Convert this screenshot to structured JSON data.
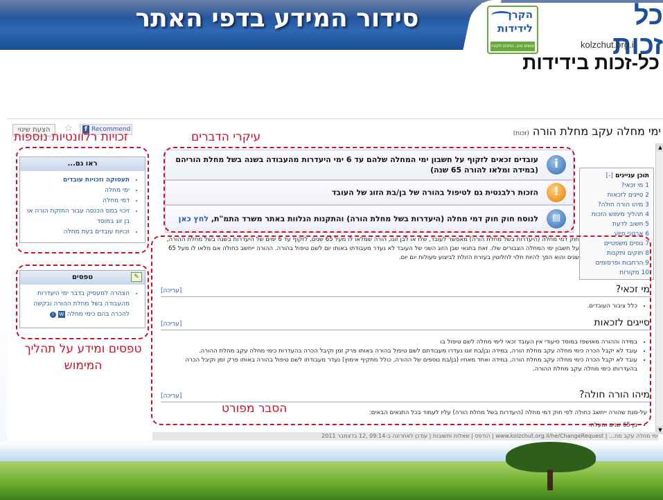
{
  "slide": {
    "title": "סידור המידע בדפי האתר",
    "logo_title": "כל זכות",
    "logo_url": "kolzchut.org.il",
    "fund_logo_line1": "הקרן",
    "fund_logo_line2": "לידידות",
    "fund_logo_tagline": "עושים טוב, נותנים תקווה",
    "subtitle": "כל-זכות בידידות"
  },
  "page": {
    "title": "ימי מחלה עקב מחלת הורה",
    "title_tag": "(זכות)",
    "suggest_button": "הצעת שינוי",
    "recommend_button": "Recommend"
  },
  "toc": {
    "heading": "תוכן עניינים",
    "toggle": "[-]",
    "items": [
      "1 מי זכאי?",
      "2 סייגים לזכאות",
      "3 מיהו הורה חולה?",
      "4 תהליך מימוש הזכות",
      "5 חשוב לדעת",
      "6 ארגוני סיוע",
      "7 גופים משפטיים",
      "8 חוקים ותקנות",
      "9 הרחבות ופרסומים",
      "10 מקורות"
    ]
  },
  "highlights": [
    {
      "text": "עובדים זכאים לזקוף על חשבון ימי המחלה שלהם עד 6 ימי היעדרות מהעבודה בשנה בשל מחלת הוריהם (במידה ומלאו להורה 65 שנה)",
      "icon": "i"
    },
    {
      "text": "הזכות רלבנטית גם לטיפול בהורה של בן/בת הזוג של העובד",
      "icon": "!"
    },
    {
      "text": "לנוסח חוק חוק דמי מחלה (היעדרות בשל מחלת הורה) והתקנות הנלוות באתר משרד התמ\"ת,",
      "link": "לחץ כאן",
      "icon": "book"
    }
  ],
  "intro": {
    "text": "חוק דמי מחלה (היעדרות בשל מחלת הורה) מאפשר לעובד, שלו או לבן זוגו, הורה שמלאו לו מעל 65 שנים, לזקוף עד 6 ימים של היעדרות בשנה בשל מחלת ההורה, על חשבון ימי המחלה הצבורים שלו. זאת בתנאי שבן הזוג השני של העובד לא נעדר מעבודתו באותו יום לשם טיפול בהורה. ההורה ייחשב כחולה אם מלאו לו מעל 65 שנים והוא הפך להיות תלוי לחלוטין בעזרת הזולת לביצוע פעולות יום יום."
  },
  "sections": [
    {
      "heading": "מי זכאי?",
      "edit": "[עריכה]",
      "bullets": [
        "כלל ציבור העובדים."
      ]
    },
    {
      "heading": "סייגים לזכאות",
      "edit": "[עריכה]",
      "bullets": [
        "במידה וההורה מאושפז במוסד סיעודי אין העובד זכאי לימי מחלה לשם טיפול בו",
        "עובד לא יקבל הכרה כימי מחלה עקב מחלת הורה, במידה ובן/בת זוגו נעדרו מעבודתם לשם טיפול בהורה באותו פרק זמן וקיבל הכרה בהעדרות כימי מחלה עקב מחלת ההורה.",
        "עובד לא יקבל הכרה כימי מחלה עקב מחלת הורה, במידה ואחד מאחיו (בן/בת נוספים של ההורה, כולל מתקיף אימוץ) נעדר מעבודתו לשם טיפול בהורה באותו פרק זמן וקיבל הכרה בהעדרותו כימי מחלה עקב מחלת ההורה."
      ]
    },
    {
      "heading": "מיהו הורה חולה?",
      "edit": "[עריכה]",
      "text": "על-מנת שהורה ייחשב כחולה לפי חוק דמי מחלה (היעדרות בשל מחלת הורה) עליו לעמוד בכל התנאים הבאים:",
      "bullets": [
        "בן 65 שנים ומעלה."
      ]
    }
  ],
  "sidebar": {
    "see_also": {
      "heading": "ראו גם...",
      "items": [
        "תעסוקה וזכויות עובדים",
        "ימי מחלה",
        "דמי מחלה",
        "זיכוי במס הכנסה עבור החזקת הורה או בן זוג במוסד",
        "זכויות עובדים בעת מחלה"
      ]
    },
    "tips": {
      "heading": "טפסים",
      "items": [
        "הצהרה למעסיק בדבר ימי היעדרות מהעבודה בשל מחלת ההורה ובקשה להכרה בהם כימי מחלה"
      ]
    }
  },
  "footer": {
    "text": "ימי מחלה עקב מח… | www.kolzchut.org.il/he/ChangeRequest | הודפס | שאלות ותשובות | עודכן לאחרונה ב-09:14 ,12 בדצמבר 2011"
  },
  "annotations": {
    "related": "זכויות רלוונטיות נוספות",
    "main_points": "עיקרי הדברים",
    "forms": "טפסים ומידע על תהליך המימוש",
    "details": "הסבר מפורט"
  },
  "colors": {
    "accent": "#d0102a",
    "banner": "#2f68b4",
    "link": "#2a5da8"
  }
}
